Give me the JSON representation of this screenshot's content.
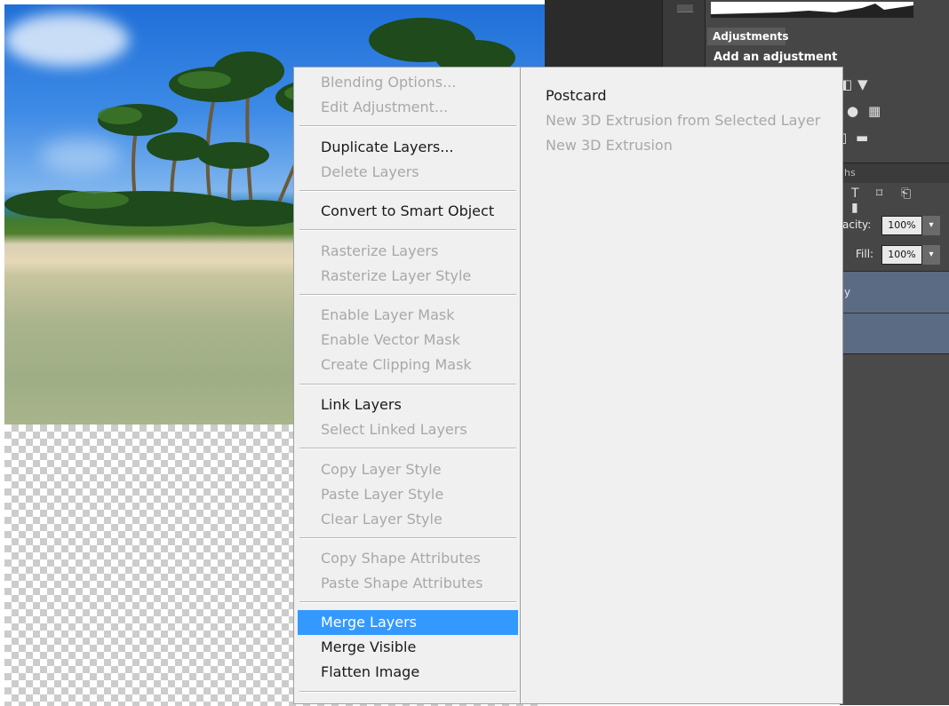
{
  "adjustments_panel": {
    "tab_label": "Adjustments",
    "title": "Add an adjustment"
  },
  "layers_panel": {
    "tab_fragment": "hs",
    "opacity_label": "acity:",
    "opacity_value": "100%",
    "fill_label": "Fill:",
    "fill_value": "100%",
    "layer_1_fragment": "y"
  },
  "context_menu": {
    "items": [
      {
        "label": "Blending Options...",
        "enabled": false
      },
      {
        "label": "Edit Adjustment...",
        "enabled": false
      },
      {
        "label": "Duplicate Layers...",
        "enabled": true
      },
      {
        "label": "Delete Layers",
        "enabled": false
      },
      {
        "label": "Convert to Smart Object",
        "enabled": true
      },
      {
        "label": "Rasterize Layers",
        "enabled": false
      },
      {
        "label": "Rasterize Layer Style",
        "enabled": false
      },
      {
        "label": "Enable Layer Mask",
        "enabled": false
      },
      {
        "label": "Enable Vector Mask",
        "enabled": false
      },
      {
        "label": "Create Clipping Mask",
        "enabled": false
      },
      {
        "label": "Link Layers",
        "enabled": true
      },
      {
        "label": "Select Linked Layers",
        "enabled": false
      },
      {
        "label": "Copy Layer Style",
        "enabled": false
      },
      {
        "label": "Paste Layer Style",
        "enabled": false
      },
      {
        "label": "Clear Layer Style",
        "enabled": false
      },
      {
        "label": "Copy Shape Attributes",
        "enabled": false
      },
      {
        "label": "Paste Shape Attributes",
        "enabled": false
      },
      {
        "label": "Merge Layers",
        "enabled": true,
        "highlighted": true
      },
      {
        "label": "Merge Visible",
        "enabled": true
      },
      {
        "label": "Flatten Image",
        "enabled": true
      }
    ]
  },
  "submenu": {
    "items": [
      {
        "label": "Postcard",
        "enabled": true
      },
      {
        "label": "New 3D Extrusion from Selected Layer",
        "enabled": false
      },
      {
        "label": "New 3D Extrusion",
        "enabled": false
      }
    ]
  },
  "colors": {
    "menu_background": "#f0f0f0",
    "menu_highlight": "#3399ff",
    "disabled_text": "#a8a8a8",
    "panel_dark": "#464646",
    "layer_selected": "#5c6b84"
  }
}
